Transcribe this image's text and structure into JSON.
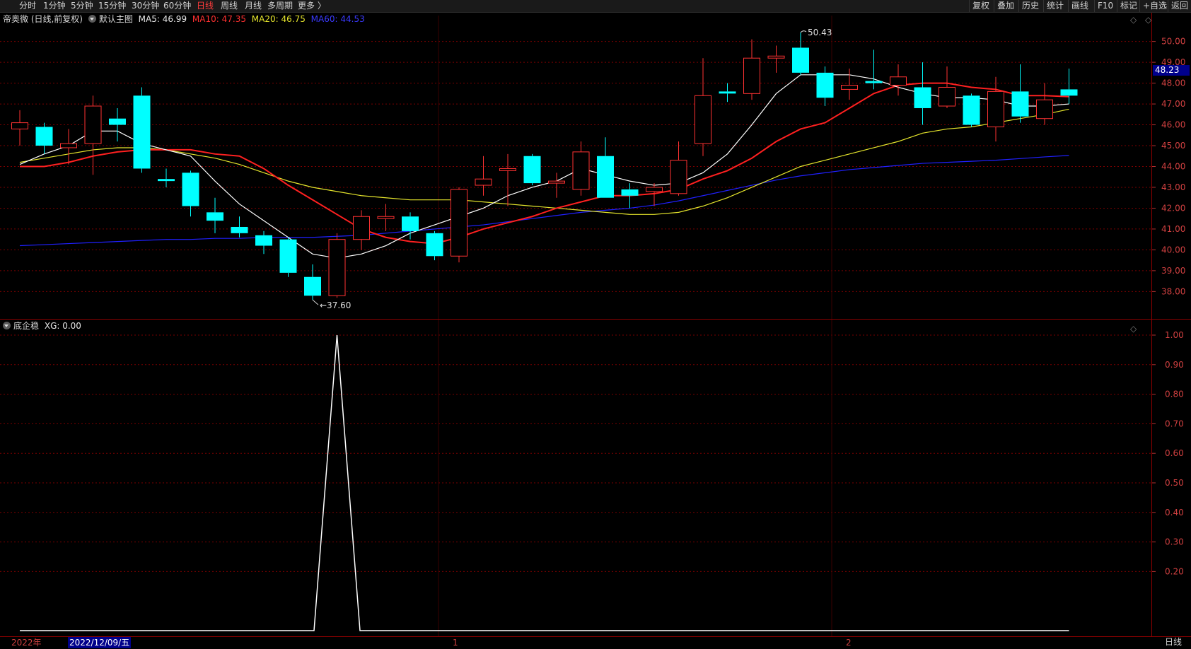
{
  "toolbar": {
    "left": [
      "分时",
      "1分钟",
      "5分钟",
      "15分钟",
      "30分钟",
      "60分钟",
      "日线",
      "周线",
      "月线",
      "多周期",
      "更多 〉"
    ],
    "active_index": 6,
    "right": [
      "复权",
      "叠加",
      "历史",
      "统计",
      "画线",
      "F10",
      "标记",
      "+自选",
      "返回"
    ]
  },
  "main_legend": {
    "stock": "帝奥微 (日线,前复权)",
    "template": "默认主图",
    "ma5": "MA5: 46.99",
    "ma10": "MA10: 47.35",
    "ma20": "MA20: 46.75",
    "ma60": "MA60: 44.53"
  },
  "sub_legend": {
    "name": "底企稳",
    "xg": "XG: 0.00"
  },
  "controls": {
    "main": "◇ ◇",
    "sub": "◇"
  },
  "price_axis": [
    "50.00",
    "49.00",
    "48.00",
    "47.00",
    "46.00",
    "45.00",
    "44.00",
    "43.00",
    "42.00",
    "41.00",
    "40.00",
    "39.00",
    "38.00"
  ],
  "sub_axis": [
    "1.00",
    "0.90",
    "0.80",
    "0.70",
    "0.60",
    "0.50",
    "0.40",
    "0.30",
    "0.20"
  ],
  "last_price": "48.23",
  "annotations": {
    "high": "50.43",
    "low": "37.60"
  },
  "x_axis": {
    "year": "2022年",
    "m1": "1",
    "m2": "2",
    "date_cursor": "2022/12/09/五",
    "period": "日线"
  },
  "colors": {
    "up": "#ff3232",
    "down": "#00ffff",
    "ma5": "#ffffff",
    "ma10": "#ff2020",
    "ma20": "#e5e52c",
    "ma60": "#2020ff",
    "grid": "#7a0000"
  },
  "chart_data": {
    "type": "candlestick",
    "candles": [
      {
        "o": 45.8,
        "c": 46.1,
        "h": 46.7,
        "l": 45.0
      },
      {
        "o": 45.9,
        "c": 45.0,
        "h": 46.1,
        "l": 44.6
      },
      {
        "o": 44.9,
        "c": 45.1,
        "h": 45.8,
        "l": 44.1
      },
      {
        "o": 45.1,
        "c": 46.9,
        "h": 47.4,
        "l": 43.6
      },
      {
        "o": 46.3,
        "c": 46.0,
        "h": 46.8,
        "l": 45.2
      },
      {
        "o": 47.4,
        "c": 43.9,
        "h": 47.8,
        "l": 43.7
      },
      {
        "o": 43.4,
        "c": 43.3,
        "h": 43.9,
        "l": 43.0
      },
      {
        "o": 43.7,
        "c": 42.1,
        "h": 43.8,
        "l": 41.6
      },
      {
        "o": 41.8,
        "c": 41.4,
        "h": 42.5,
        "l": 40.8
      },
      {
        "o": 41.1,
        "c": 40.8,
        "h": 41.6,
        "l": 40.6
      },
      {
        "o": 40.7,
        "c": 40.2,
        "h": 40.9,
        "l": 39.8
      },
      {
        "o": 40.5,
        "c": 38.9,
        "h": 40.6,
        "l": 38.7
      },
      {
        "o": 38.7,
        "c": 37.8,
        "h": 39.3,
        "l": 37.6
      },
      {
        "o": 37.8,
        "c": 40.5,
        "h": 40.8,
        "l": 37.7
      },
      {
        "o": 40.5,
        "c": 41.6,
        "h": 41.9,
        "l": 40.0
      },
      {
        "o": 41.5,
        "c": 41.6,
        "h": 42.2,
        "l": 40.9
      },
      {
        "o": 41.6,
        "c": 40.9,
        "h": 41.8,
        "l": 40.5
      },
      {
        "o": 40.8,
        "c": 39.7,
        "h": 40.9,
        "l": 39.5
      },
      {
        "o": 39.7,
        "c": 42.9,
        "h": 43.0,
        "l": 39.4
      },
      {
        "o": 43.1,
        "c": 43.4,
        "h": 44.5,
        "l": 42.6
      },
      {
        "o": 43.8,
        "c": 43.9,
        "h": 44.6,
        "l": 42.1
      },
      {
        "o": 44.5,
        "c": 43.2,
        "h": 44.6,
        "l": 43.1
      },
      {
        "o": 43.2,
        "c": 43.3,
        "h": 43.7,
        "l": 42.5
      },
      {
        "o": 42.9,
        "c": 44.7,
        "h": 45.2,
        "l": 42.6
      },
      {
        "o": 44.5,
        "c": 42.5,
        "h": 45.4,
        "l": 42.5
      },
      {
        "o": 42.9,
        "c": 42.6,
        "h": 43.2,
        "l": 42.0
      },
      {
        "o": 42.8,
        "c": 43.0,
        "h": 43.2,
        "l": 42.1
      },
      {
        "o": 42.7,
        "c": 44.3,
        "h": 45.2,
        "l": 42.6
      },
      {
        "o": 45.1,
        "c": 47.4,
        "h": 49.2,
        "l": 44.5
      },
      {
        "o": 47.6,
        "c": 47.5,
        "h": 48.0,
        "l": 47.1
      },
      {
        "o": 47.5,
        "c": 49.2,
        "h": 50.1,
        "l": 47.2
      },
      {
        "o": 49.2,
        "c": 49.3,
        "h": 49.8,
        "l": 48.5
      },
      {
        "o": 49.7,
        "c": 48.5,
        "h": 50.43,
        "l": 48.4
      },
      {
        "o": 48.5,
        "c": 47.3,
        "h": 48.8,
        "l": 46.9
      },
      {
        "o": 47.7,
        "c": 47.9,
        "h": 48.7,
        "l": 47.2
      },
      {
        "o": 48.1,
        "c": 48.0,
        "h": 49.6,
        "l": 47.7
      },
      {
        "o": 47.9,
        "c": 48.3,
        "h": 48.9,
        "l": 47.4
      },
      {
        "o": 47.8,
        "c": 46.8,
        "h": 49.0,
        "l": 46.0
      },
      {
        "o": 46.9,
        "c": 47.8,
        "h": 48.8,
        "l": 46.8
      },
      {
        "o": 47.4,
        "c": 46.0,
        "h": 47.5,
        "l": 45.9
      },
      {
        "o": 45.9,
        "c": 47.6,
        "h": 48.3,
        "l": 45.2
      },
      {
        "o": 47.6,
        "c": 46.4,
        "h": 48.9,
        "l": 46.1
      },
      {
        "o": 46.3,
        "c": 47.2,
        "h": 48.0,
        "l": 46.0
      },
      {
        "o": 47.7,
        "c": 47.4,
        "h": 48.7,
        "l": 47.0
      }
    ],
    "ma5": [
      44.1,
      44.6,
      45.0,
      45.7,
      45.7,
      45.1,
      44.8,
      44.5,
      43.3,
      42.2,
      41.4,
      40.6,
      39.8,
      39.6,
      39.8,
      40.2,
      40.8,
      41.2,
      41.6,
      42.0,
      42.6,
      43.0,
      43.3,
      43.9,
      43.6,
      43.3,
      43.1,
      43.2,
      43.7,
      44.6,
      46.0,
      47.5,
      48.4,
      48.4,
      48.4,
      48.2,
      47.8,
      47.5,
      47.3,
      47.3,
      47.2,
      46.9,
      46.9,
      47.0
    ],
    "ma10": [
      44.0,
      44.0,
      44.2,
      44.5,
      44.7,
      44.8,
      44.8,
      44.8,
      44.6,
      44.5,
      43.9,
      43.1,
      42.4,
      41.7,
      41.0,
      40.6,
      40.4,
      40.3,
      40.6,
      41.0,
      41.3,
      41.6,
      42.0,
      42.3,
      42.6,
      42.6,
      42.7,
      42.9,
      43.4,
      43.8,
      44.4,
      45.2,
      45.8,
      46.1,
      46.8,
      47.5,
      47.9,
      48.0,
      48.0,
      47.8,
      47.7,
      47.4,
      47.4,
      47.35
    ],
    "ma20": [
      44.2,
      44.4,
      44.6,
      44.8,
      44.9,
      44.9,
      44.8,
      44.6,
      44.4,
      44.1,
      43.7,
      43.3,
      43.0,
      42.8,
      42.6,
      42.5,
      42.4,
      42.4,
      42.4,
      42.3,
      42.2,
      42.1,
      42.0,
      41.9,
      41.8,
      41.7,
      41.7,
      41.8,
      42.1,
      42.5,
      43.0,
      43.5,
      44.0,
      44.3,
      44.6,
      44.9,
      45.2,
      45.6,
      45.8,
      45.9,
      46.1,
      46.3,
      46.5,
      46.75
    ],
    "ma60": [
      40.2,
      40.25,
      40.3,
      40.35,
      40.4,
      40.45,
      40.5,
      40.5,
      40.55,
      40.55,
      40.6,
      40.6,
      40.6,
      40.65,
      40.7,
      40.8,
      40.9,
      41.0,
      41.1,
      41.2,
      41.35,
      41.5,
      41.65,
      41.8,
      41.9,
      42.0,
      42.15,
      42.35,
      42.6,
      42.85,
      43.1,
      43.35,
      43.55,
      43.7,
      43.85,
      43.95,
      44.05,
      44.15,
      44.2,
      44.25,
      44.3,
      44.38,
      44.46,
      44.53
    ],
    "xg": [
      0,
      0,
      0,
      0,
      0,
      0,
      0,
      0,
      0,
      0,
      0,
      0,
      0,
      1,
      0,
      0,
      0,
      0,
      0,
      0,
      0,
      0,
      0,
      0,
      0,
      0,
      0,
      0,
      0,
      0,
      0,
      0,
      0,
      0,
      0,
      0,
      0,
      0,
      0,
      0,
      0,
      0,
      0,
      0
    ],
    "price_ylim": [
      37.3,
      50.7
    ],
    "sub_ylim": [
      0,
      1.0
    ]
  }
}
